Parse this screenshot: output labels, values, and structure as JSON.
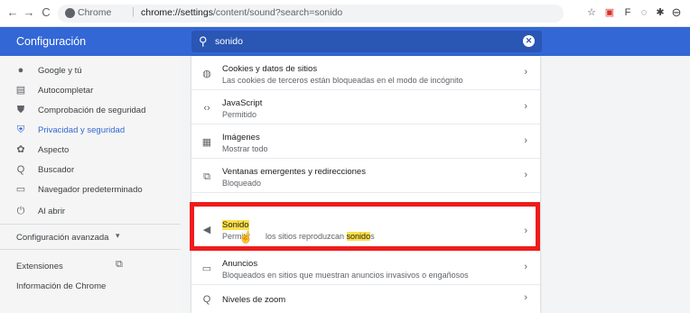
{
  "browser": {
    "prefix": "Chrome",
    "url_host": "chrome://settings",
    "url_path": "/content/sound?search=sonido"
  },
  "header": {
    "title": "Configuración",
    "search_value": "sonido"
  },
  "sidebar": {
    "items": [
      {
        "label": "Google y tú",
        "icon": "person-icon"
      },
      {
        "label": "Autocompletar",
        "icon": "clipboard-icon"
      },
      {
        "label": "Comprobación de seguridad",
        "icon": "shield-icon"
      },
      {
        "label": "Privacidad y seguridad",
        "icon": "shield-lock-icon",
        "active": true
      },
      {
        "label": "Aspecto",
        "icon": "palette-icon"
      },
      {
        "label": "Buscador",
        "icon": "search-icon"
      },
      {
        "label": "Navegador predeterminado",
        "icon": "browser-icon"
      },
      {
        "label": "Al abrir",
        "icon": "power-icon"
      }
    ],
    "advanced": "Configuración avanzada",
    "extensions": "Extensiones",
    "about": "Información de Chrome"
  },
  "content": {
    "rows": [
      {
        "title": "Cookies y datos de sitios",
        "subtitle": "Las cookies de terceros están bloqueadas en el modo de incógnito",
        "icon": "cookie-icon"
      },
      {
        "title": "JavaScript",
        "subtitle": "Permitido",
        "icon": "code-icon"
      },
      {
        "title": "Imágenes",
        "subtitle": "Mostrar todo",
        "icon": "image-icon"
      },
      {
        "title": "Ventanas emergentes y redirecciones",
        "subtitle": "Bloqueado",
        "icon": "popup-icon"
      },
      {
        "title": "Sonido",
        "subtitle_a": "Permitir ",
        "subtitle_b": " los sitios reproduzcan ",
        "subtitle_mark": "sonido",
        "subtitle_c": "s",
        "icon": "speaker-icon"
      },
      {
        "title": "Anuncios",
        "subtitle": "Bloqueados en sitios que muestran anuncios invasivos o engañosos",
        "icon": "ads-icon"
      },
      {
        "title": "Niveles de zoom",
        "icon": "zoom-icon"
      }
    ]
  },
  "colors": {
    "header": "#3367d6",
    "highlight_box": "#ef1c1c",
    "search_mark": "#fde047"
  }
}
